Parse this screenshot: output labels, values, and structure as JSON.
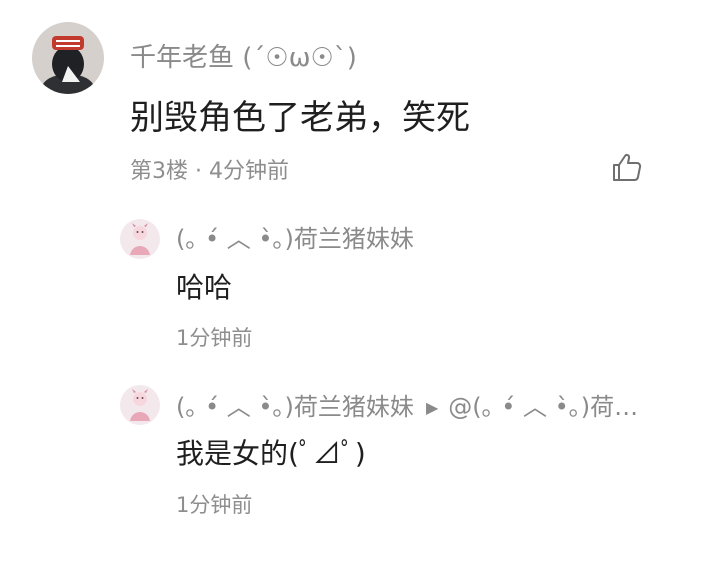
{
  "comment": {
    "author": "千年老鱼 (´☉ω☉`)",
    "text": "别毁角色了老弟，笑死",
    "meta": "第3楼 · 4分钟前",
    "like_icon": "thumbs-up-icon",
    "avatar_icon": "user-avatar-icon"
  },
  "replies": [
    {
      "author": "(｡ •́ ︿ •̀｡)荷兰猪妹妹",
      "text": "哈哈",
      "time": "1分钟前",
      "avatar_icon": "cartoon-avatar-icon"
    },
    {
      "author": "(｡ •́ ︿ •̀｡)荷兰猪妹妹",
      "reply_arrow": "▶",
      "reply_to": "@(｡ •́ ︿ •̀｡)荷…",
      "text": "我是女的(ﾟ⊿ﾟ)",
      "time": "1分钟前",
      "avatar_icon": "cartoon-avatar-icon"
    }
  ],
  "colors": {
    "meta_text": "#8e8e8e",
    "name_text": "#8a8a8a",
    "body_text": "#1f1f1f",
    "avatar_bg": "#d9d3cf",
    "reply_avatar_bg": "#f1e6ea"
  }
}
